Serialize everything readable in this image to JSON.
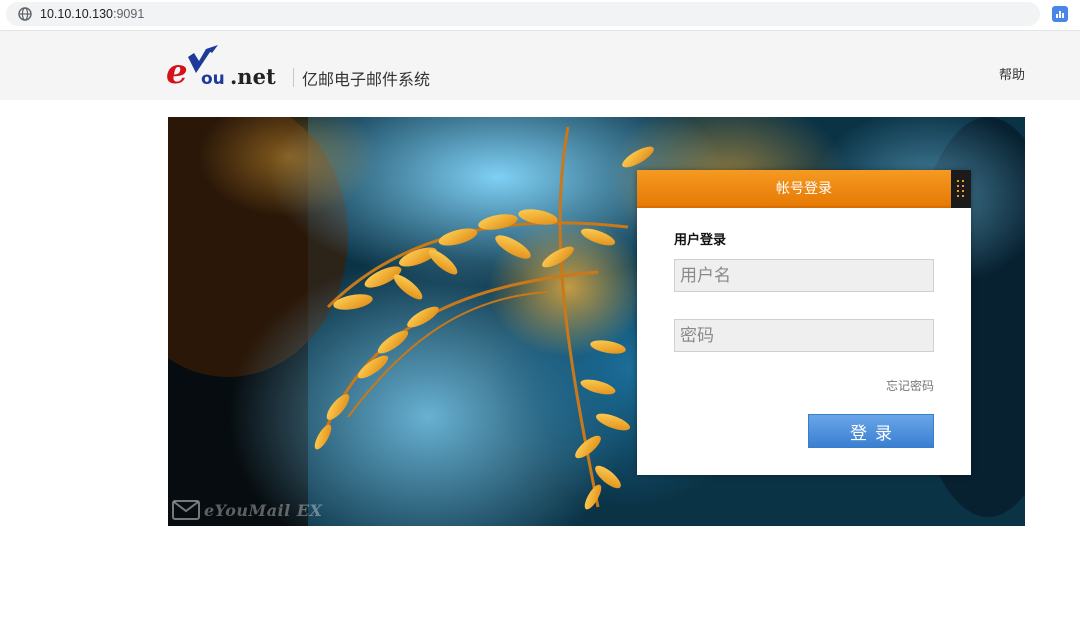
{
  "browser": {
    "url_host": "10.10.10.130",
    "url_port": ":9091",
    "globe_icon": "globe-icon",
    "extension_icon": "bar-chart-icon"
  },
  "header": {
    "logo_text": "eYou.net",
    "system_title": "亿邮电子邮件系统",
    "help_label": "帮助"
  },
  "hero": {
    "watermark_text": "eYouMail EX"
  },
  "login": {
    "panel_title": "帐号登录",
    "subtitle": "用户登录",
    "username_placeholder": "用户名",
    "password_placeholder": "密码",
    "forgot_label": "忘记密码",
    "submit_label": "登录",
    "qr_toggle_icon": "grip-dots-icon"
  },
  "colors": {
    "header_orange": "#e67a05",
    "button_blue": "#3a7fd2",
    "logo_red": "#d3121a",
    "logo_blue": "#1d3a9a"
  }
}
